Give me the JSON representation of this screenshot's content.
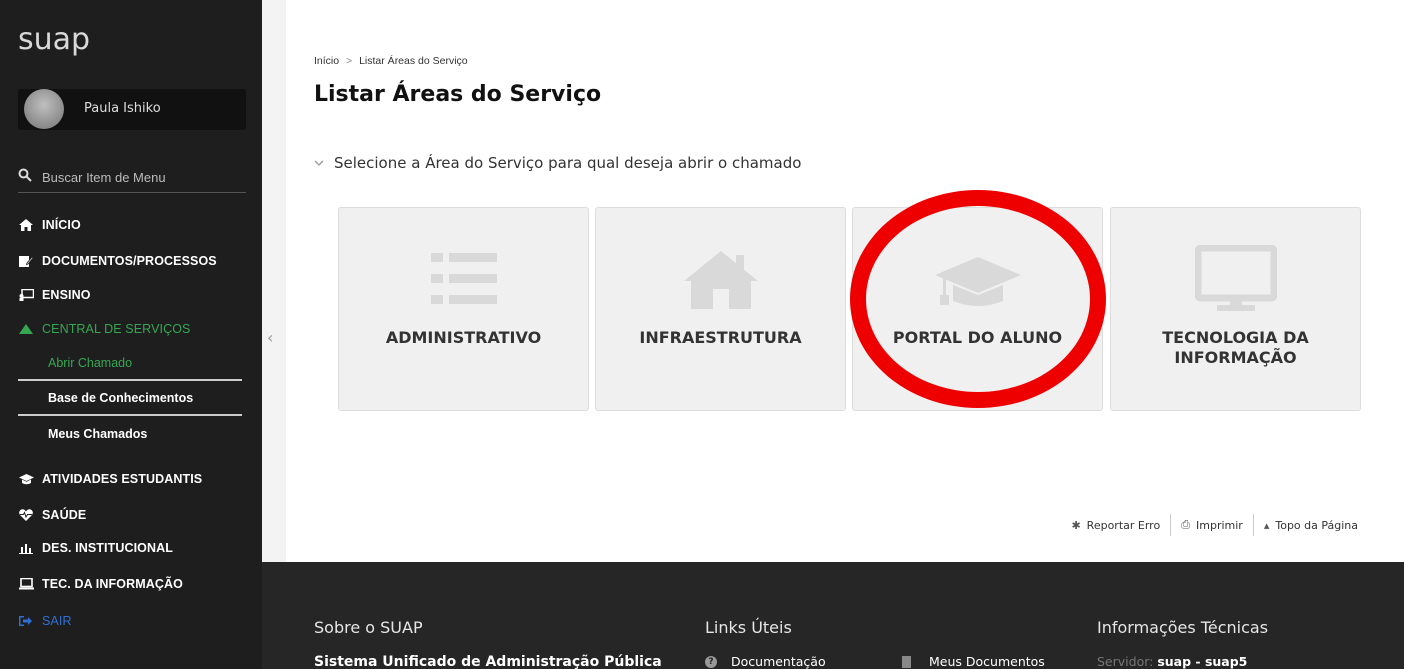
{
  "app": {
    "logo": "suap",
    "user_name": "Paula Ishiko",
    "search_placeholder": "Buscar Item de Menu"
  },
  "menu": {
    "items": [
      {
        "label": "INÍCIO",
        "icon": "home-icon"
      },
      {
        "label": "DOCUMENTOS/PROCESSOS",
        "icon": "document-edit-icon"
      },
      {
        "label": "ENSINO",
        "icon": "chalkboard-icon"
      },
      {
        "label": "CENTRAL DE SERVIÇOS",
        "icon": "triangle-icon",
        "active": true
      },
      {
        "label": "ATIVIDADES ESTUDANTIS",
        "icon": "graduation-cap-icon"
      },
      {
        "label": "SAÚDE",
        "icon": "heartbeat-icon"
      },
      {
        "label": "DES. INSTITUCIONAL",
        "icon": "bar-chart-icon"
      },
      {
        "label": "TEC. DA INFORMAÇÃO",
        "icon": "laptop-icon"
      },
      {
        "label": "SAIR",
        "icon": "sign-out-icon"
      }
    ],
    "submenu": [
      {
        "label": "Abrir Chamado",
        "current": true
      },
      {
        "label": "Base de Conhecimentos"
      },
      {
        "label": "Meus Chamados"
      }
    ]
  },
  "breadcrumb": {
    "home": "Início",
    "separator": ">",
    "current": "Listar Áreas do Serviço"
  },
  "page": {
    "title": "Listar Áreas do Serviço",
    "section_label": "Selecione a Área do Serviço para qual deseja abrir o chamado"
  },
  "cards": [
    {
      "label": "ADMINISTRATIVO",
      "icon": "list-icon"
    },
    {
      "label": "INFRAESTRUTURA",
      "icon": "house-icon"
    },
    {
      "label": "PORTAL DO ALUNO",
      "icon": "graduation-cap-icon",
      "highlighted": true
    },
    {
      "label": "TECNOLOGIA DA INFORMAÇÃO",
      "icon": "monitor-icon"
    }
  ],
  "tools": {
    "report": "Reportar Erro",
    "print": "Imprimir",
    "top": "Topo da Página"
  },
  "footer": {
    "about_title": "Sobre o SUAP",
    "about_text": "Sistema Unificado de Administração Pública",
    "links_title": "Links Úteis",
    "link_docs": "Documentação",
    "link_my_docs": "Meus Documentos",
    "tech_title": "Informações Técnicas",
    "server_label": "Servidor:",
    "server_value": "suap - suap5"
  },
  "colors": {
    "sidebar_bg": "#1e1e1e",
    "active_green": "#35a753",
    "card_bg": "#f0f0f0",
    "highlight_red": "#ee0000",
    "footer_bg": "#262626"
  }
}
